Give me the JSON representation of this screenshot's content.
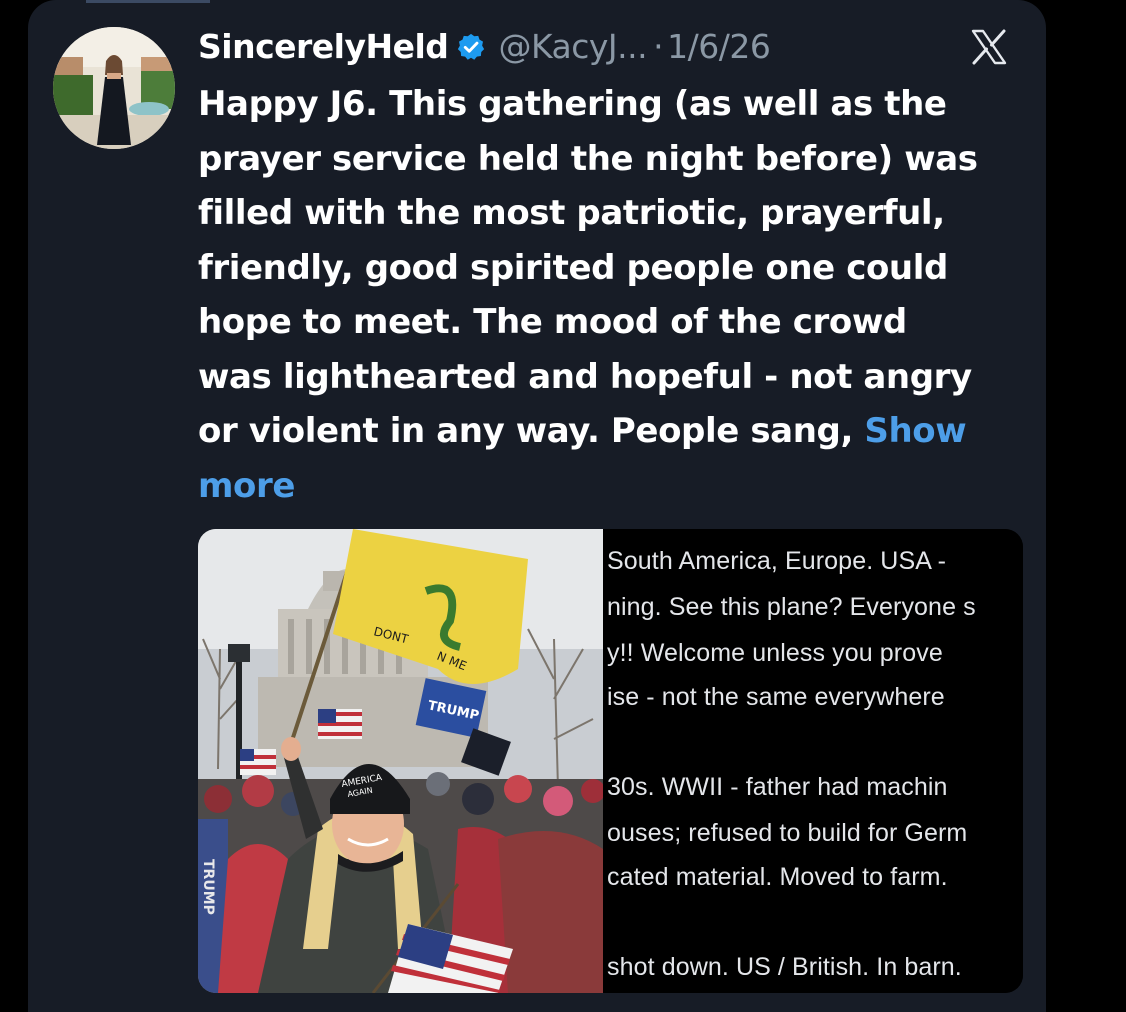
{
  "tweet": {
    "display_name": "SincerelyHeld",
    "handle": "@KacyJ...",
    "separator": "·",
    "date": "1/6/26",
    "text_lines": [
      "Happy J6. This gathering (as well as the",
      "prayer service held the night before) was",
      "filled with the most patriotic, prayerful,",
      "friendly, good spirited people one could",
      "hope to meet. The mood of the crowd",
      "was lighthearted and hopeful - not angry",
      "or violent in any way.  People sang, "
    ],
    "show_more_part1": "Show",
    "show_more_part2": "more"
  },
  "photo_marks": {
    "flag_text_1": "DONT",
    "flag_text_2": "N ME",
    "banner_text": "TRUMP",
    "hat_text_1": "AMERICA",
    "hat_text_2": "AGAIN",
    "side_text": "TRUMP"
  },
  "screenshot_text": {
    "lines": [
      "South America, Europe. USA -",
      "ning. See this plane? Everyone s",
      "y!! Welcome unless you prove",
      "ise - not the same everywhere",
      "",
      "30s. WWII - father had machin",
      "ouses; refused to build for Germ",
      "cated material. Moved to farm.",
      "",
      "shot down. US / British. In barn."
    ]
  },
  "colors": {
    "card_background": "#171c26",
    "text": "#ffffff",
    "muted": "#8b98a5",
    "link": "#4d9ee8",
    "verified_badge": "#1d9bf0"
  },
  "icons": {
    "verified": "verified-badge-icon",
    "platform": "x-logo-icon"
  }
}
